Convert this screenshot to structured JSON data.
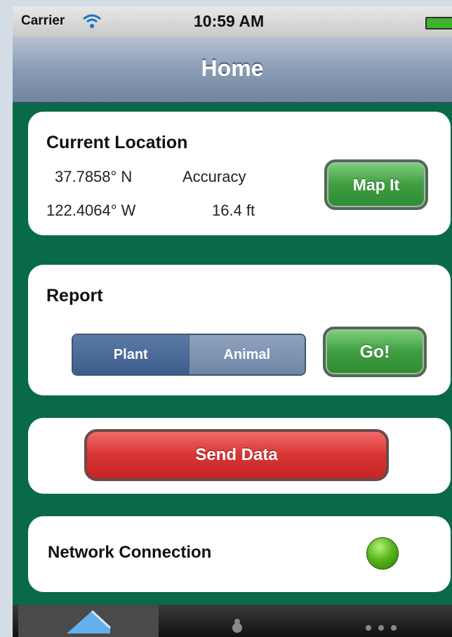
{
  "status_bar": {
    "carrier": "Carrier",
    "time": "10:59 AM"
  },
  "nav": {
    "title": "Home"
  },
  "location": {
    "title": "Current Location",
    "latitude": "37.7858° N",
    "longitude": "122.4064° W",
    "accuracy_label": "Accuracy",
    "accuracy_value": "16.4 ft",
    "map_button": "Map It"
  },
  "report": {
    "title": "Report",
    "segments": [
      {
        "label": "Plant",
        "selected": true
      },
      {
        "label": "Animal",
        "selected": false
      }
    ],
    "go_button": "Go!"
  },
  "send": {
    "button": "Send Data"
  },
  "network": {
    "label": "Network Connection",
    "status_color": "#58b81a"
  },
  "tabbar": {
    "tabs": [
      {
        "icon": "home-icon",
        "active": true
      },
      {
        "icon": "bug-icon",
        "active": false
      },
      {
        "icon": "more-icon",
        "active": false
      }
    ]
  },
  "colors": {
    "background": "#096a47",
    "accent_green": "#3f9e3f",
    "accent_red": "#d83434",
    "segment_blue": "#3c5d8b"
  }
}
